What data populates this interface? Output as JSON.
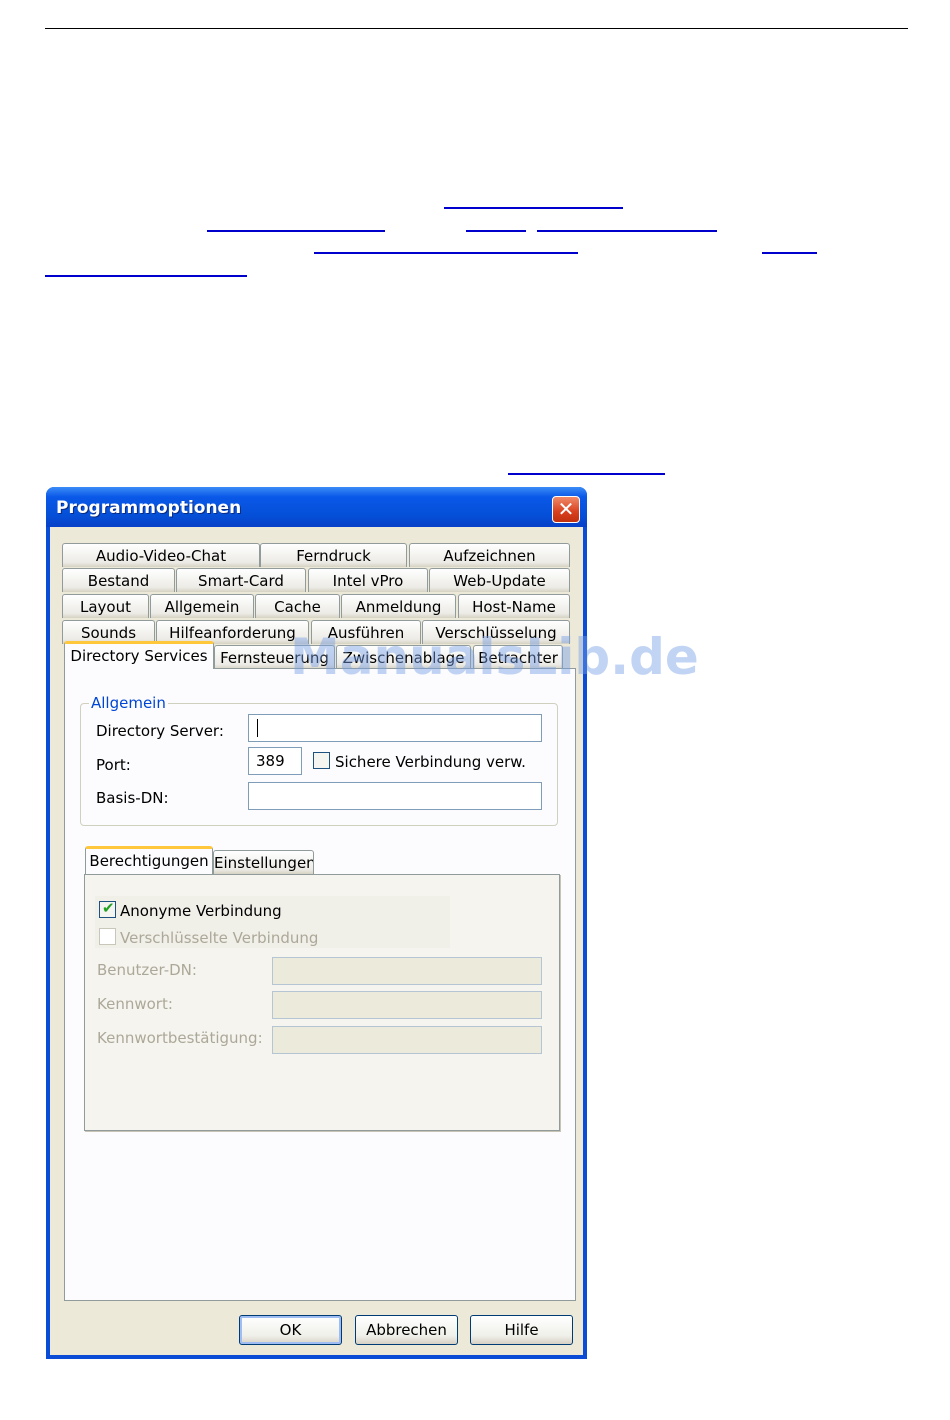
{
  "dialog": {
    "title": "Programmoptionen",
    "close_glyph": "✕",
    "tab_rows": [
      [
        "Audio-Video-Chat",
        "Ferndruck",
        "Aufzeichnen"
      ],
      [
        "Bestand",
        "Smart-Card",
        "Intel vPro",
        "Web-Update"
      ],
      [
        "Layout",
        "Allgemein",
        "Cache",
        "Anmeldung",
        "Host-Name"
      ],
      [
        "Sounds",
        "Hilfeanforderung",
        "Ausführen",
        "Verschlüsselung"
      ],
      [
        "Directory Services",
        "Fernsteuerung",
        "Zwischenablage",
        "Betrachter"
      ]
    ],
    "active_tab": "Directory Services",
    "allgemein": {
      "group_label": "Allgemein",
      "directory_server_label": "Directory Server:",
      "directory_server_value": "",
      "port_label": "Port:",
      "port_value": "389",
      "secure_label": "Sichere Verbindung verw.",
      "secure_checked": false,
      "basis_dn_label": "Basis-DN:",
      "basis_dn_value": ""
    },
    "subtabs": [
      "Berechtigungen",
      "Einstellungen"
    ],
    "active_subtab": "Berechtigungen",
    "berechtigungen": {
      "anonymous_label": "Anonyme Verbindung",
      "anonymous_checked": true,
      "encrypted_label": "Verschlüsselte Verbindung",
      "encrypted_checked": false,
      "user_dn_label": "Benutzer-DN:",
      "password_label": "Kennwort:",
      "password_confirm_label": "Kennwortbestätigung:"
    },
    "buttons": {
      "ok": "OK",
      "cancel": "Abbrechen",
      "help": "Hilfe"
    },
    "check_glyph": "✔"
  },
  "watermark": "ManualsLib.de",
  "colors": {
    "titlebar": "#0a58e8",
    "dialog_bg": "#ece9d8",
    "link": "#0000cc",
    "active_tab_accent": "#ffc83c",
    "group_label": "#0046d5"
  }
}
